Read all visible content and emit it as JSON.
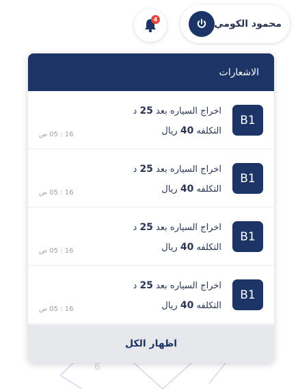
{
  "header": {
    "user_name": "محمود الكومي",
    "notification_count": "4"
  },
  "panel": {
    "title": "الاشعارات",
    "show_all_label": "اظهار الكل",
    "notifications": [
      {
        "badge": "B1",
        "text1": "اخراج السياره بعد ",
        "num1": "25",
        "suffix1": " د",
        "text2": "التكلفه ",
        "num2": "40",
        "suffix2": " ريال",
        "time": "16 : 05 ص"
      },
      {
        "badge": "B1",
        "text1": "اخراج السياره بعد ",
        "num1": "25",
        "suffix1": " د",
        "text2": "التكلفه ",
        "num2": "40",
        "suffix2": " ريال",
        "time": "16 : 05 ص"
      },
      {
        "badge": "B1",
        "text1": "اخراج السياره بعد ",
        "num1": "25",
        "suffix1": " د",
        "text2": "التكلفه ",
        "num2": "40",
        "suffix2": " ريال",
        "time": "16 : 05 ص"
      },
      {
        "badge": "B1",
        "text1": "اخراج السياره بعد ",
        "num1": "25",
        "suffix1": " د",
        "text2": "التكلفه ",
        "num2": "40",
        "suffix2": " ريال",
        "time": "16 : 05 ص"
      }
    ]
  },
  "colors": {
    "primary": "#1d3466",
    "badge_red": "#e8453c"
  },
  "icons": {
    "power": "power-icon",
    "bell": "bell-icon"
  }
}
